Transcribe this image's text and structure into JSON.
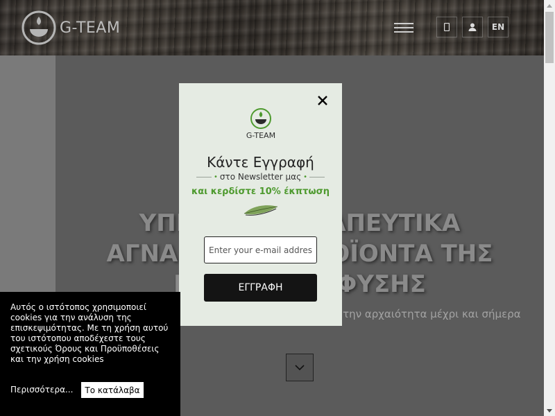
{
  "header": {
    "brand": "G-TEAM",
    "lang_label": "EN",
    "icons": {
      "phone": "phone-icon",
      "user": "user-icon",
      "menu": "hamburger-menu-icon"
    }
  },
  "hero": {
    "title_line1": "ΥΠΕΡΟΧΑ ΘΕΡΑΠΕΥΤΙΚΑ",
    "title_line2": "ΑΓΝΑ ΦΥΣΙΚΑ ΠΡΟΪΟΝΤΑ ΤΗΣ",
    "title_line3": "ΕΛΛΗΝΙΚΗΣ ΦΥΣΗΣ",
    "subtitle": "τροφή από την αρχαιότητα μέχρι και σήμερα"
  },
  "modal": {
    "brand": "G-TEAM",
    "title": "Κάντε Εγγραφή",
    "subtitle": "στο Newsletter μας",
    "offer": "και κερδίστε 10% έκπτωση",
    "email_placeholder": "Enter your e-mail address",
    "signup_label": "ΕΓΓΡΑΦΗ",
    "accent_color": "#4e9a2f"
  },
  "cookie": {
    "text": "Αυτός ο ιστότοπος χρησιμοποιεί cookies για την ανάλυση της επισκεψιμότητας. Με τη χρήση αυτού του ιστότοπου αποδέχεστε τους σχετικούς Όρους και Προϋποθέσεις και την χρήση cookies",
    "more_label": "Περισσότερα...",
    "ok_label": "Το κατάλαβα"
  }
}
